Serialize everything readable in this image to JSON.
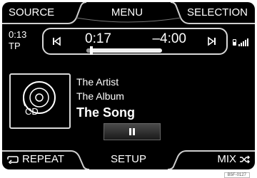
{
  "top_bar": {
    "source_label": "SOURCE",
    "menu_label": "MENU",
    "selection_label": "SELECTION"
  },
  "status": {
    "total_elapsed": "0:13",
    "tp_label": "TP"
  },
  "playback": {
    "current_time": "0:17",
    "remaining_time": "–4:00",
    "progress_fraction": 0.07
  },
  "track": {
    "artist": "The Artist",
    "album": "The Album",
    "song": "The Song",
    "media_label": "CD"
  },
  "bottom_bar": {
    "repeat_label": "REPEAT",
    "setup_label": "SETUP",
    "mix_label": "MIX"
  },
  "image_code": "B5F-0127",
  "icons": {
    "prev": "skip-back-icon",
    "next": "skip-forward-icon",
    "pause": "pause-icon",
    "repeat": "repeat-icon",
    "mix": "shuffle-icon",
    "phone": "phone-icon",
    "signal": "signal-strength-icon",
    "cd": "cd-icon"
  },
  "colors": {
    "screen_bg": "#000000",
    "text": "#ffffff",
    "frame": "#d8d8d8"
  }
}
